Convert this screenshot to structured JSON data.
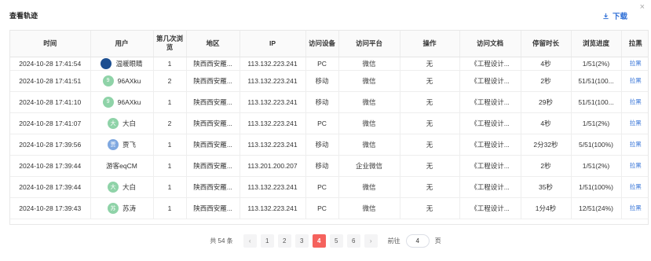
{
  "header": {
    "title": "查看轨迹",
    "download_label": "下载",
    "close_label": "×"
  },
  "columns": [
    "时间",
    "用户",
    "第几次浏览",
    "地区",
    "IP",
    "访问设备",
    "访问平台",
    "操作",
    "访问文档",
    "停留时长",
    "浏览进度",
    "拉黑"
  ],
  "rows": [
    {
      "time": "2024-10-28 17:41:54",
      "user": "温暖眼睛",
      "avatar": "",
      "avatar_color": "#1d4f91",
      "visit": "1",
      "region": "陕西西安雁...",
      "ip": "113.132.223.241",
      "device": "PC",
      "platform": "微信",
      "action": "无",
      "doc": "《工程设计...",
      "duration": "4秒",
      "progress": "1/51(2%)",
      "block": "拉黑"
    },
    {
      "time": "2024-10-28 17:41:51",
      "user": "96AXku",
      "avatar": "9",
      "avatar_color": "#8fd3a8",
      "visit": "2",
      "region": "陕西西安雁...",
      "ip": "113.132.223.241",
      "device": "移动",
      "platform": "微信",
      "action": "无",
      "doc": "《工程设计...",
      "duration": "2秒",
      "progress": "51/51(100...",
      "block": "拉黑"
    },
    {
      "time": "2024-10-28 17:41:10",
      "user": "96AXku",
      "avatar": "9",
      "avatar_color": "#8fd3a8",
      "visit": "1",
      "region": "陕西西安雁...",
      "ip": "113.132.223.241",
      "device": "移动",
      "platform": "微信",
      "action": "无",
      "doc": "《工程设计...",
      "duration": "29秒",
      "progress": "51/51(100...",
      "block": "拉黑"
    },
    {
      "time": "2024-10-28 17:41:07",
      "user": "大白",
      "avatar": "大",
      "avatar_color": "#8fd3a8",
      "visit": "2",
      "region": "陕西西安雁...",
      "ip": "113.132.223.241",
      "device": "PC",
      "platform": "微信",
      "action": "无",
      "doc": "《工程设计...",
      "duration": "4秒",
      "progress": "1/51(2%)",
      "block": "拉黑"
    },
    {
      "time": "2024-10-28 17:39:56",
      "user": "贾飞",
      "avatar": "贾",
      "avatar_color": "#7fa8e0",
      "visit": "1",
      "region": "陕西西安雁...",
      "ip": "113.132.223.241",
      "device": "移动",
      "platform": "微信",
      "action": "无",
      "doc": "《工程设计...",
      "duration": "2分32秒",
      "progress": "5/51(100%)",
      "block": "拉黑"
    },
    {
      "time": "2024-10-28 17:39:44",
      "user": "游客eqCM",
      "avatar": "",
      "avatar_color": "",
      "visit": "1",
      "region": "陕西西安雁...",
      "ip": "113.201.200.207",
      "device": "移动",
      "platform": "企业微信",
      "action": "无",
      "doc": "《工程设计...",
      "duration": "2秒",
      "progress": "1/51(2%)",
      "block": "拉黑"
    },
    {
      "time": "2024-10-28 17:39:44",
      "user": "大白",
      "avatar": "大",
      "avatar_color": "#8fd3a8",
      "visit": "1",
      "region": "陕西西安雁...",
      "ip": "113.132.223.241",
      "device": "PC",
      "platform": "微信",
      "action": "无",
      "doc": "《工程设计...",
      "duration": "35秒",
      "progress": "1/51(100%)",
      "block": "拉黑"
    },
    {
      "time": "2024-10-28 17:39:43",
      "user": "苏涛",
      "avatar": "苏",
      "avatar_color": "#8fd3a8",
      "visit": "1",
      "region": "陕西西安雁...",
      "ip": "113.132.223.241",
      "device": "PC",
      "platform": "微信",
      "action": "无",
      "doc": "《工程设计...",
      "duration": "1分4秒",
      "progress": "12/51(24%)",
      "block": "拉黑"
    }
  ],
  "pagination": {
    "total_label": "共 54 条",
    "prev": "‹",
    "next": "›",
    "pages": [
      "1",
      "2",
      "3",
      "4",
      "5",
      "6"
    ],
    "current": "4",
    "goto_label": "前往",
    "goto_value": "4",
    "page_unit": "页"
  }
}
